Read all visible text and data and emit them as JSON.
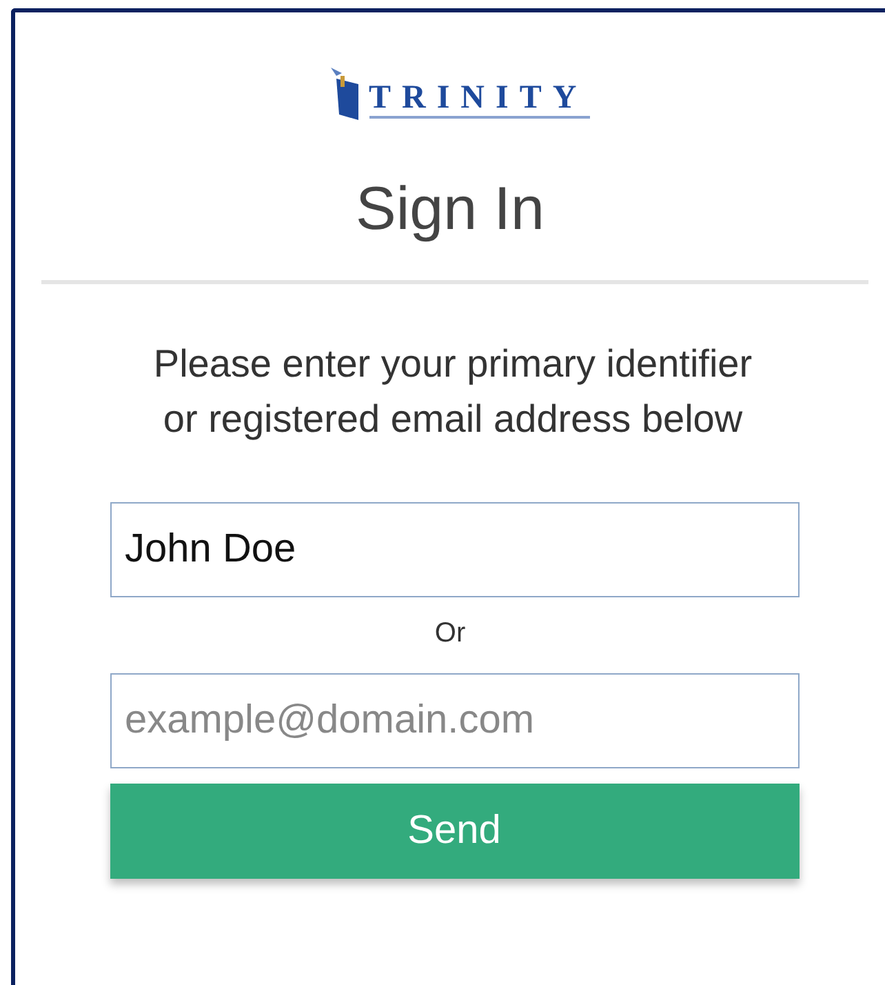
{
  "logo": {
    "name": "TRINITY"
  },
  "title": "Sign In",
  "instructions": "Please enter your primary identifier or registered email address below",
  "identifier_field": {
    "value": "John Doe"
  },
  "separator": "Or",
  "email_field": {
    "placeholder": "example@domain.com"
  },
  "buttons": [
    {
      "label": "Send"
    }
  ]
}
